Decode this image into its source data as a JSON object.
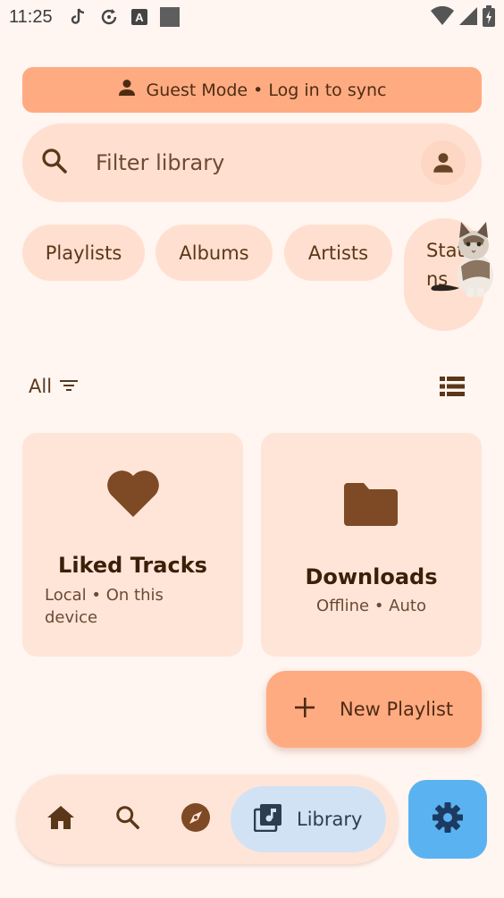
{
  "status_bar": {
    "time": "11:25",
    "icons": [
      "tiktok-icon",
      "sync-icon",
      "font-icon",
      "square-icon"
    ],
    "right_icons": [
      "wifi-icon",
      "signal-icon",
      "battery-icon"
    ]
  },
  "guest_banner": {
    "icon": "person-icon",
    "text": "Guest Mode • Log in to sync"
  },
  "search": {
    "icon": "search-icon",
    "placeholder": "Filter library",
    "avatar_icon": "person-icon"
  },
  "chips": [
    {
      "label": "Playlists"
    },
    {
      "label": "Albums"
    },
    {
      "label": "Artists"
    },
    {
      "label": "Stations"
    }
  ],
  "filter": {
    "label": "All",
    "icon": "filter-icon",
    "view_icon": "list-view-icon"
  },
  "cards": [
    {
      "title": "Liked Tracks",
      "subtitle": "Local • On this device",
      "icon": "heart-icon"
    },
    {
      "title": "Downloads",
      "subtitle": "Offline • Auto",
      "icon": "folder-icon"
    }
  ],
  "fab": {
    "icon": "plus-icon",
    "label": "New Playlist"
  },
  "nav": {
    "items": [
      "home-icon",
      "search-icon",
      "explore-icon"
    ],
    "active": {
      "icon": "library-music-icon",
      "label": "Library"
    }
  },
  "settings": {
    "icon": "gear-icon"
  },
  "colors": {
    "background": "#fff5f1",
    "accent": "#ffab82",
    "surface": "#ffe0d0",
    "brown": "#7d4a25",
    "active_nav": "#d2e2f5",
    "settings_blue": "#5ab3f0"
  }
}
